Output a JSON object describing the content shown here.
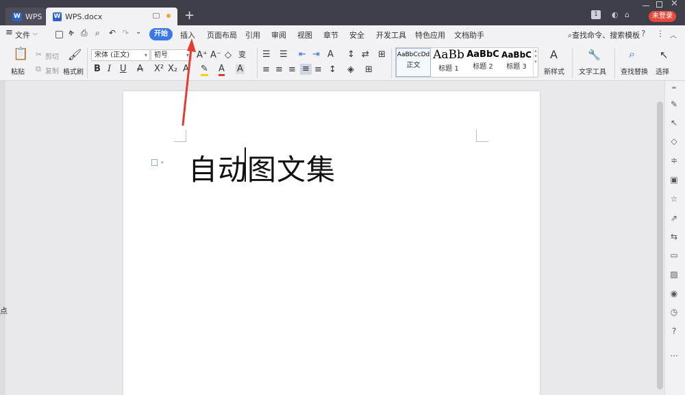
{
  "titlebar": {
    "app_tab": "WPS",
    "doc_tab": "WPS.docx",
    "add_tab": "+",
    "badge": "1",
    "login": "未登录"
  },
  "menubar": {
    "file": "文件",
    "items": [
      "开始",
      "插入",
      "页面布局",
      "引用",
      "审阅",
      "视图",
      "章节",
      "安全",
      "开发工具",
      "特色应用",
      "文档助手"
    ],
    "search": "查找命令、搜索模板",
    "help": "?"
  },
  "ribbon": {
    "paste": "粘贴",
    "cut": "剪切",
    "copy": "复制",
    "format_painter": "格式刷",
    "font_name": "宋体 (正文)",
    "font_size": "初号",
    "styles": [
      {
        "sample": "AaBbCcDd",
        "name": "正文"
      },
      {
        "sample": "AaBb",
        "name": "标题 1"
      },
      {
        "sample": "AaBbC",
        "name": "标题 2"
      },
      {
        "sample": "AaBbC",
        "name": "标题 3"
      }
    ],
    "new_style": "新样式",
    "text_tools": "文字工具",
    "find_replace": "查找替换",
    "select": "选择"
  },
  "document": {
    "text": "自动图文集"
  },
  "left_char": "点"
}
